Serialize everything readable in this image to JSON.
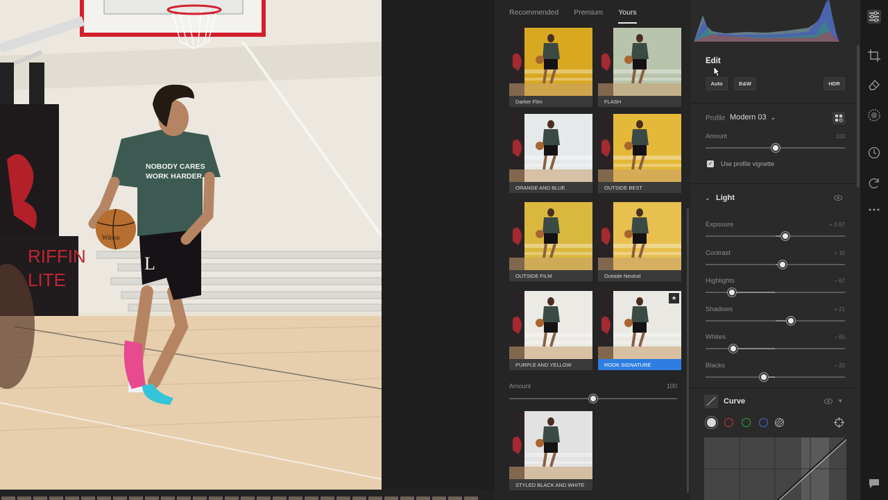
{
  "presets_panel": {
    "tabs": [
      {
        "label": "Recommended",
        "active": false
      },
      {
        "label": "Premium",
        "active": false
      },
      {
        "label": "Yours",
        "active": true
      }
    ],
    "presets": [
      {
        "label": "Darker Film",
        "tone": "#d8a820",
        "selected": false,
        "starred": false
      },
      {
        "label": "FLASH",
        "tone": "#b9c4ad",
        "selected": false,
        "starred": false
      },
      {
        "label": "ORANGE AND BLUE",
        "tone": "#e6e9ea",
        "selected": false,
        "starred": false
      },
      {
        "label": "OUTSIDE BEST",
        "tone": "#e4b93a",
        "selected": false,
        "starred": false
      },
      {
        "label": "OUTSIDE FILM",
        "tone": "#d9b83d",
        "selected": false,
        "starred": false
      },
      {
        "label": "Outside Neutral",
        "tone": "#e7c050",
        "selected": false,
        "starred": false
      },
      {
        "label": "PURPLE AND YELLOW",
        "tone": "#ebeae4",
        "selected": false,
        "starred": false
      },
      {
        "label": "ROOK SIGNATURE",
        "tone": "#e9e8e2",
        "selected": true,
        "starred": true
      },
      {
        "label": "STYLED BLACK AND WHITE",
        "tone": "#e2e2e2",
        "selected": false,
        "starred": false
      }
    ],
    "amount": {
      "label": "Amount",
      "value": "100",
      "level": 0.5
    }
  },
  "edit_panel": {
    "title": "Edit",
    "buttons": {
      "auto": "Auto",
      "bw": "B&W",
      "hdr": "HDR"
    },
    "profile": {
      "label": "Profile",
      "value": "Modern 03"
    },
    "profile_amount": {
      "label": "Amount",
      "value": "100",
      "level": 0.5
    },
    "vignette": {
      "label": "Use profile vignette",
      "checked": true
    },
    "light": {
      "title": "Light",
      "sliders": [
        {
          "label": "Exposure",
          "value": "+ 0.67",
          "level": 0.57
        },
        {
          "label": "Contrast",
          "value": "+ 10",
          "level": 0.55
        },
        {
          "label": "Highlights",
          "value": "− 67",
          "level": 0.19
        },
        {
          "label": "Shadows",
          "value": "+ 21",
          "level": 0.61
        },
        {
          "label": "Whites",
          "value": "− 65",
          "level": 0.2
        },
        {
          "label": "Blacks",
          "value": "− 20",
          "level": 0.42
        }
      ]
    },
    "curve": {
      "title": "Curve",
      "channels": [
        "#d8d8d8",
        "#d33333",
        "#2fa83c",
        "#3f6fe0"
      ]
    }
  },
  "photo": {
    "shirt_text_line1": "NOBODY CARES",
    "shirt_text_line2": "WORK HARDER",
    "banner_text_line1": "RIFFIN",
    "banner_text_line2": "LITE",
    "ball_text": "Wilson",
    "shorts_letter": "L"
  },
  "colors": {
    "accent": "#2f7de1",
    "panel": "#2a2a2a",
    "presets_bg": "#252525"
  }
}
